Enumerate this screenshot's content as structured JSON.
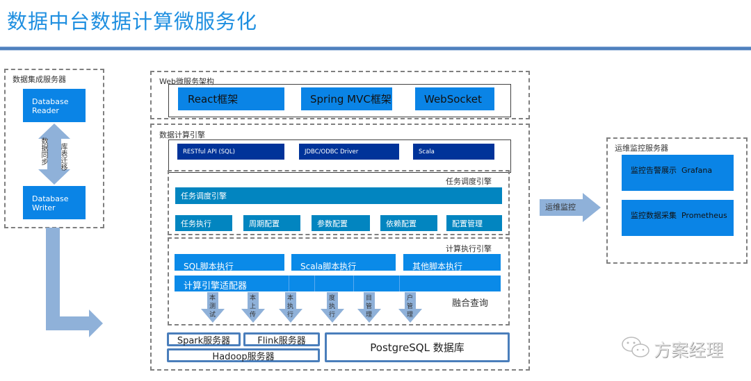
{
  "title": "数据中台数据计算微服务化",
  "integration": {
    "title": "数据集成服务器",
    "reader": "Database Reader",
    "writer": "Database Writer",
    "sync_left": "数据同步",
    "sync_right": "库表迁移"
  },
  "web": {
    "title": "Web微服务架构",
    "items": [
      "React框架",
      "Spring MVC框架",
      "WebSocket"
    ]
  },
  "compute": {
    "title": "数据计算引擎",
    "apis": [
      "RESTful API (SQL)",
      "JDBC/ODBC Driver",
      "Scala"
    ],
    "scheduler": {
      "label": "任务调度引擎",
      "bar": "任务调度引擎",
      "items": [
        "任务执行",
        "周期配置",
        "参数配置",
        "依赖配置",
        "配置管理"
      ]
    },
    "executor": {
      "label": "计算执行引擎",
      "scripts": [
        "SQL脚本执行",
        "Scala脚本执行",
        "其他脚本执行"
      ],
      "adapter": "计算引擎适配器",
      "arrows": [
        "本测试",
        "本上传",
        "本执行",
        "度执行",
        "目管理",
        "户管理"
      ],
      "fusion": "融合查询"
    },
    "servers": {
      "spark": "Spark服务器",
      "flink": "Flink服务器",
      "hadoop": "Hadoop服务器",
      "postgres": "PostgreSQL 数据库"
    }
  },
  "ops": {
    "arrow_label": "运维监控",
    "title": "运维监控服务器",
    "items": [
      "监控告警展示  Grafana",
      "监控数据采集  Prometheus"
    ]
  },
  "watermark": "方案经理",
  "colors": {
    "title": "#1f8fe0",
    "rule": "#4f81bd",
    "box_blue": "#0a84e6",
    "navy": "#003399",
    "teal": "#0285c0",
    "arrow": "#8fb1d9"
  }
}
